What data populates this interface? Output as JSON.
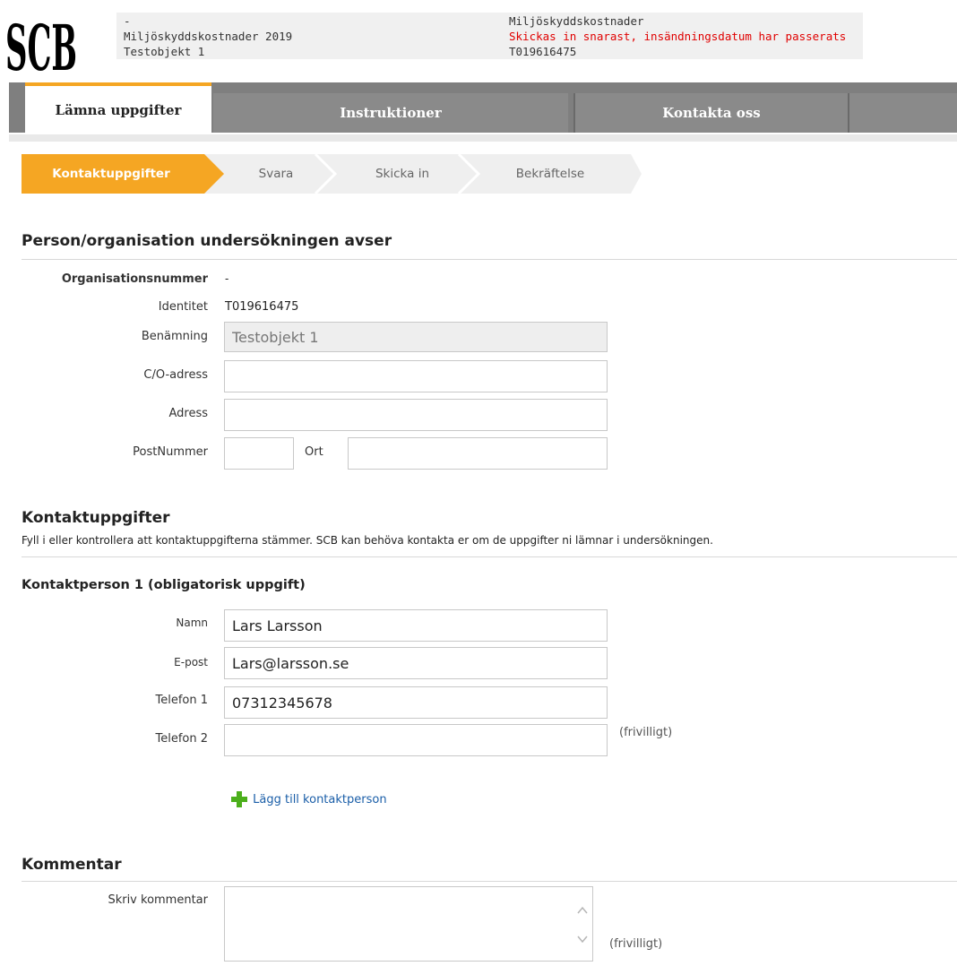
{
  "header": {
    "logo_text": "SCB",
    "left_lines": [
      "-",
      "Miljöskyddskostnader 2019",
      "Testobjekt 1"
    ],
    "right_title": "Miljöskyddskostnader",
    "right_status": "Skickas in snarast, insändningsdatum har passerats",
    "right_id": "T019616475"
  },
  "nav": {
    "items": [
      "Lämna uppgifter",
      "Instruktioner",
      "Kontakta oss"
    ],
    "accent": "#f5a623"
  },
  "steps": {
    "items": [
      "Kontaktuppgifter",
      "Svara",
      "Skicka in",
      "Bekräftelse"
    ]
  },
  "org": {
    "title": "Person/organisation undersökningen avser",
    "orgnr_label": "Organisationsnummer",
    "orgnr_value": "-",
    "identity_label": "Identitet",
    "identity_value": "T019616475",
    "name_label": "Benämning",
    "name_value": "Testobjekt 1",
    "co_label": "C/O-adress",
    "co_value": "",
    "address_label": "Adress",
    "address_value": "",
    "postnr_label": "PostNummer",
    "postnr_value": "",
    "city_label": "Ort",
    "city_value": ""
  },
  "contact": {
    "title": "Kontaktuppgifter",
    "description": "Fyll i eller kontrollera att kontaktuppgifterna stämmer. SCB kan behöva kontakta er om de uppgifter ni lämnar i undersökningen.",
    "person_title": "Kontaktperson 1 (obligatorisk uppgift)",
    "name_label": "Namn",
    "name_value": "Lars Larsson",
    "email_label": "E-post",
    "email_value": "Lars@larsson.se",
    "phone1_label": "Telefon 1",
    "phone1_value": "07312345678",
    "phone2_label": "Telefon 2",
    "phone2_value": "",
    "optional_note": "(frivilligt)",
    "add_person_label": "Lägg till kontaktperson"
  },
  "comment": {
    "title": "Kommentar",
    "label": "Skriv kommentar",
    "value": "",
    "optional_note": "(frivilligt)"
  }
}
